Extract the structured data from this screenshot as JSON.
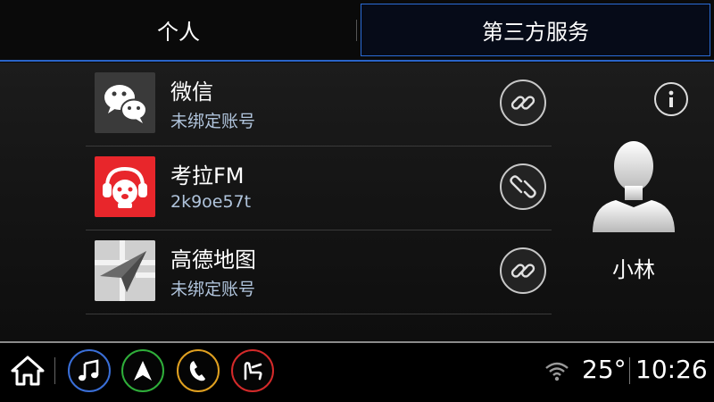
{
  "tabs": [
    {
      "label": "个人",
      "active": false
    },
    {
      "label": "第三方服务",
      "active": true
    }
  ],
  "services": [
    {
      "name": "微信",
      "status": "未绑定账号",
      "icon": "wechat-icon"
    },
    {
      "name": "考拉FM",
      "status": "2k9oe57t",
      "icon": "kaola-fm-icon"
    },
    {
      "name": "高德地图",
      "status": "未绑定账号",
      "icon": "amap-icon"
    }
  ],
  "user": {
    "name": "小林"
  },
  "status_bar": {
    "temperature": "25°",
    "time": "10:26"
  },
  "colors": {
    "accent": "#2a64c8",
    "music": "#3a6fd8",
    "nav": "#2fae3a",
    "phone": "#e0a020",
    "seat": "#d42a2a",
    "kaola_red": "#e8262b"
  }
}
